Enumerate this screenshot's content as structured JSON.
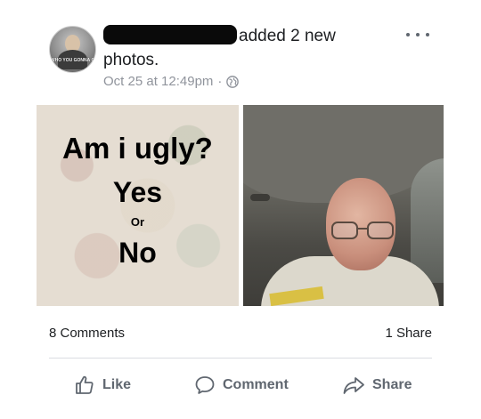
{
  "post": {
    "headline_suffix": "added 2 new photos.",
    "timestamp": "Oct 25 at 12:49pm",
    "meta_separator": "·",
    "privacy_icon": "globe-icon",
    "avatar_caption": "WHO YOU GONNA C"
  },
  "photos": {
    "meme": {
      "title": "Am i ugly?",
      "option_yes": "Yes",
      "option_or": "Or",
      "option_no": "No"
    }
  },
  "stats": {
    "comments": "8 Comments",
    "shares": "1 Share"
  },
  "actions": {
    "like_label": "Like",
    "comment_label": "Comment",
    "share_label": "Share",
    "like_icon": "thumbs-up-icon",
    "comment_icon": "comment-bubble-icon",
    "share_icon": "share-arrow-icon"
  },
  "colors": {
    "text": "#1c1e21",
    "muted": "#90949c",
    "action": "#606770",
    "divider": "#dadde1"
  }
}
